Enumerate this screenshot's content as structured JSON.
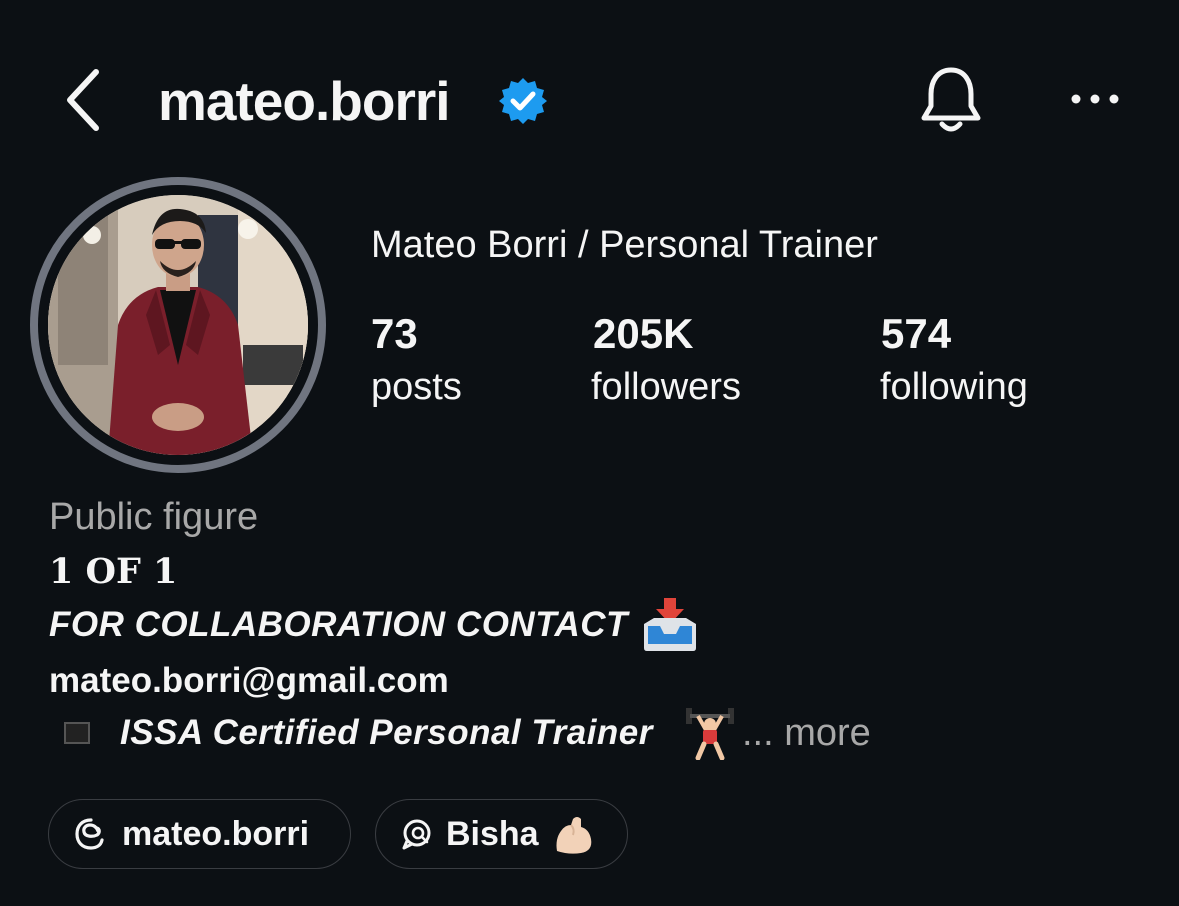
{
  "header": {
    "username": "mateo.borri",
    "verified_color": "#1d9bf0",
    "icons": [
      "chevron-left-icon",
      "verified-badge-icon",
      "bell-icon",
      "more-horizontal-icon"
    ]
  },
  "profile": {
    "display_name": "Mateo Borri / Personal Trainer",
    "stats": [
      {
        "value": "73",
        "label": "posts"
      },
      {
        "value": "205K",
        "label": "followers"
      },
      {
        "value": "574",
        "label": "following"
      }
    ]
  },
  "bio": {
    "category": "Public figure",
    "line1": "1 OF 1",
    "line2": "FOR COLLABORATION CONTACT",
    "line3": "mateo.borri@gmail.com",
    "line4": "ISSA Certified Personal Trainer",
    "more": "... more"
  },
  "chips": [
    {
      "label": "mateo.borri",
      "icon": "threads-icon"
    },
    {
      "label": "Bisha",
      "icon": "chat-search-icon"
    }
  ]
}
